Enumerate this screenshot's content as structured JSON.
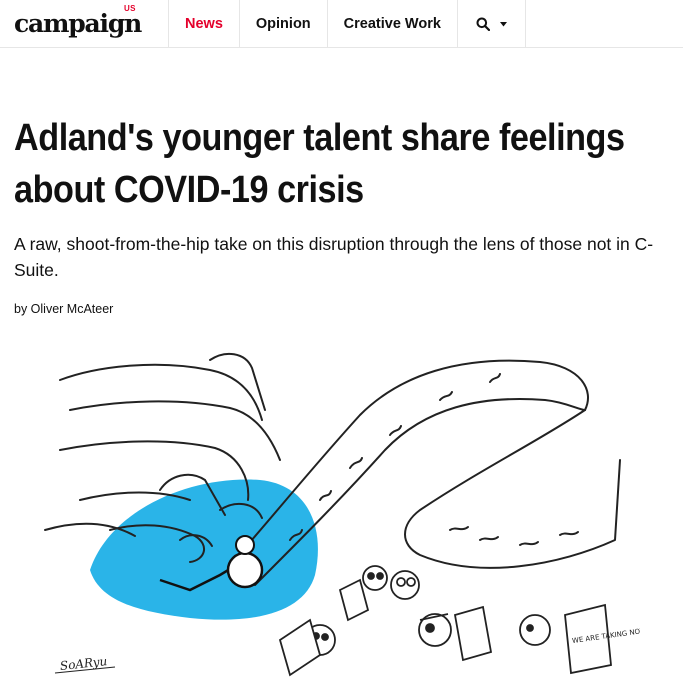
{
  "header": {
    "logo_text": "campaign",
    "logo_region": "US",
    "nav": [
      {
        "label": "News",
        "active": true
      },
      {
        "label": "Opinion",
        "active": false
      },
      {
        "label": "Creative Work",
        "active": false
      }
    ],
    "search_icon": "search-icon",
    "dropdown_icon": "caret-down-icon",
    "accent_color": "#e4002b"
  },
  "article": {
    "headline": "Adland's younger talent share feelings about COVID-19 crisis",
    "standfirst": "A raw, shoot-from-the-hip take on this disruption through the lens of those not in C-Suite.",
    "byline": "by Oliver McAteer",
    "illustration": {
      "artist_signature": "SoARyu",
      "sign_text": "WE ARE TAKING NOTES",
      "spot_color": "#2ab4e8"
    }
  }
}
